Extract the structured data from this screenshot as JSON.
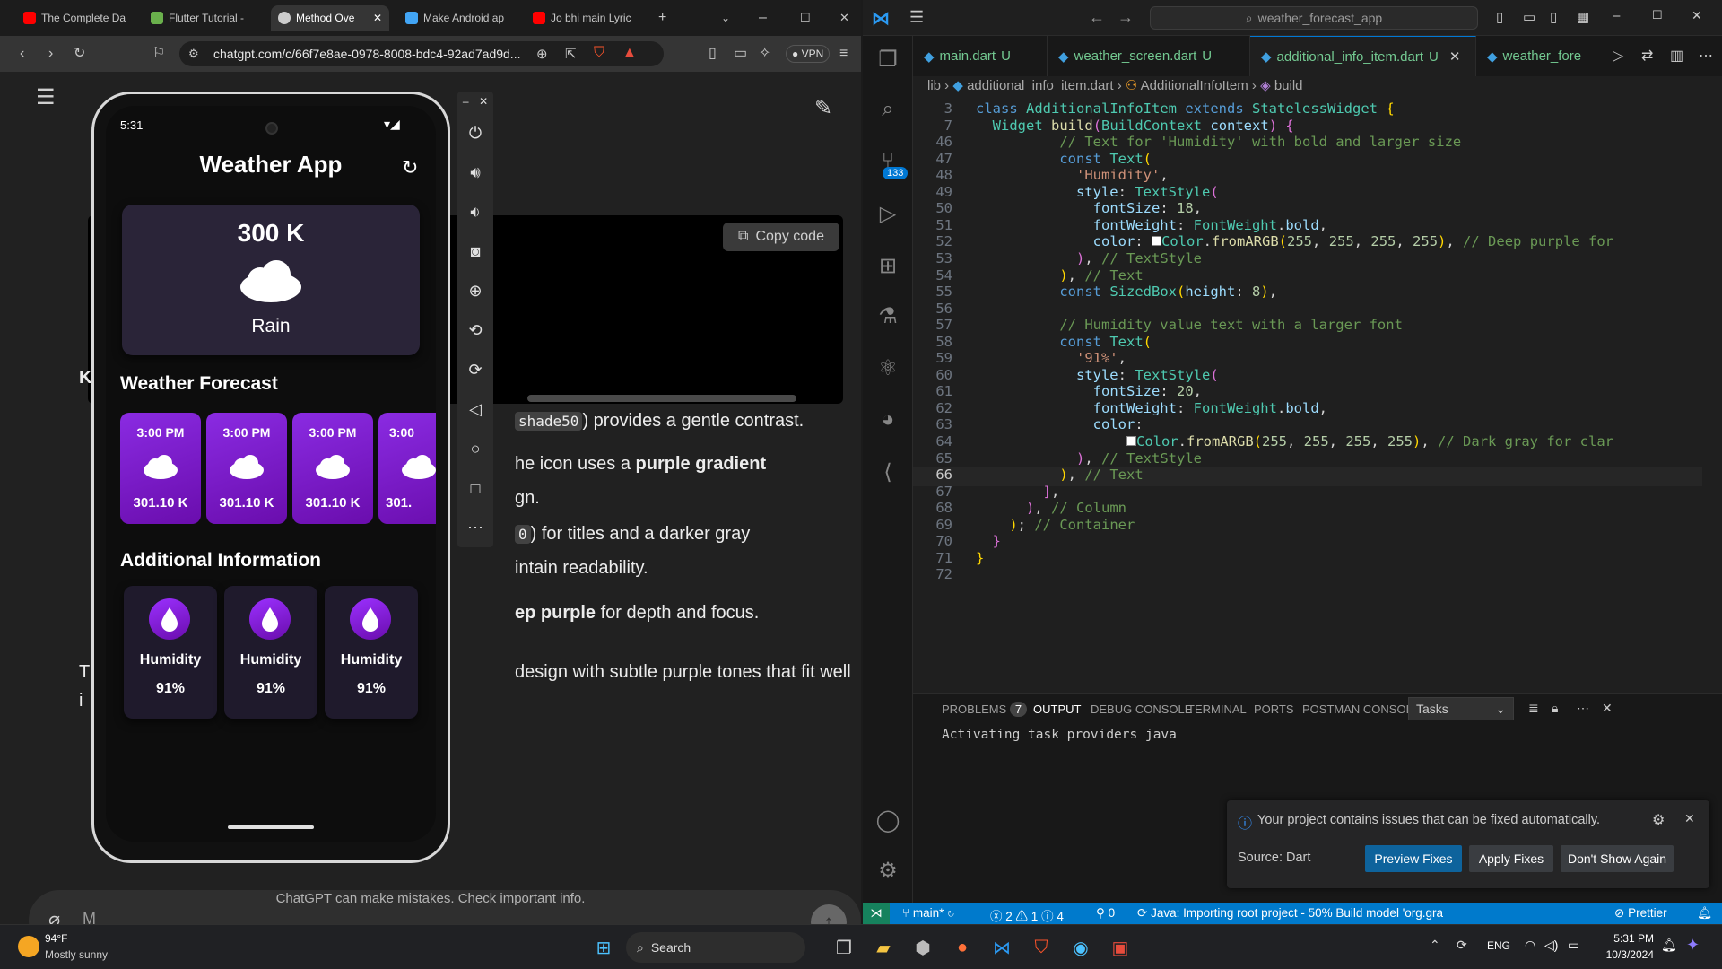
{
  "browser": {
    "tabs": [
      {
        "label": "The Complete Da",
        "color": "#ff0000"
      },
      {
        "label": "Flutter Tutorial -",
        "color": "#6ab04c"
      },
      {
        "label": "Method Ove",
        "color": "#cccccc"
      },
      {
        "label": "Make Android ap",
        "color": "#42a5f5"
      },
      {
        "label": "Jo bhi main Lyric",
        "color": "#ff0000"
      }
    ],
    "url": "chatgpt.com/c/66f7e8ae-0978-8008-bdc4-92ad7ad9d...",
    "vpn_label": "VPN",
    "copy_code": "Copy code",
    "prose": {
      "line1_code": "shade50",
      "line1": ") provides a gentle contrast.",
      "line2_a": "he icon uses a ",
      "line2_b": "purple gradient",
      "line3": "gn.",
      "line4_code": "0",
      "line4": ") for titles and a darker gray",
      "line5": "intain readability.",
      "line6_a": "ep purple",
      "line6_b": " for depth and focus.",
      "line7": " design with subtle purple tones that fit well",
      "frag_k": "K",
      "frag_t": "T",
      "frag_i": "i",
      "frag_m": "M"
    },
    "disclaimer": "ChatGPT can make mistakes. Check important info."
  },
  "phone": {
    "time": "5:31",
    "app_title": "Weather App",
    "main": {
      "temp": "300 K",
      "condition": "Rain"
    },
    "forecast_title": "Weather Forecast",
    "forecast": [
      {
        "time": "3:00 PM",
        "temp": "301.10 K"
      },
      {
        "time": "3:00 PM",
        "temp": "301.10 K"
      },
      {
        "time": "3:00 PM",
        "temp": "301.10 K"
      },
      {
        "time": "3:00",
        "temp": "301."
      }
    ],
    "additional_title": "Additional Information",
    "additional": [
      {
        "label": "Humidity",
        "value": "91%"
      },
      {
        "label": "Humidity",
        "value": "91%"
      },
      {
        "label": "Humidity",
        "value": "91%"
      }
    ]
  },
  "vscode": {
    "search": "weather_forecast_app",
    "tabs": [
      {
        "label": "main.dart",
        "flag": "U"
      },
      {
        "label": "weather_screen.dart",
        "flag": "U"
      },
      {
        "label": "additional_info_item.dart",
        "flag": "U"
      },
      {
        "label": "weather_fore",
        "flag": ""
      }
    ],
    "breadcrumb": [
      "lib",
      "additional_info_item.dart",
      "AdditionalInfoItem",
      "build"
    ],
    "scm_badge": "133",
    "panel_tabs": [
      "PROBLEMS",
      "OUTPUT",
      "DEBUG CONSOLE",
      "TERMINAL",
      "PORTS",
      "POSTMAN CONSOLE"
    ],
    "problems_count": "7",
    "tasks_select": "Tasks",
    "output_text": "Activating task providers java",
    "notification": {
      "message": "Your project contains issues that can be fixed automatically.",
      "source": "Source: Dart",
      "buttons": [
        "Preview Fixes",
        "Apply Fixes",
        "Don't Show Again"
      ]
    },
    "status": {
      "branch": "main*",
      "errors": "2",
      "warnings": "1",
      "infos": "4",
      "ports": "0",
      "java": "Java: Importing root project - 50% Build model 'org.gra",
      "prettier": "Prettier"
    }
  },
  "taskbar": {
    "weather_temp": "94°F",
    "weather_desc": "Mostly sunny",
    "search": "Search",
    "lang": "ENG",
    "time": "5:31 PM",
    "date": "10/3/2024"
  }
}
